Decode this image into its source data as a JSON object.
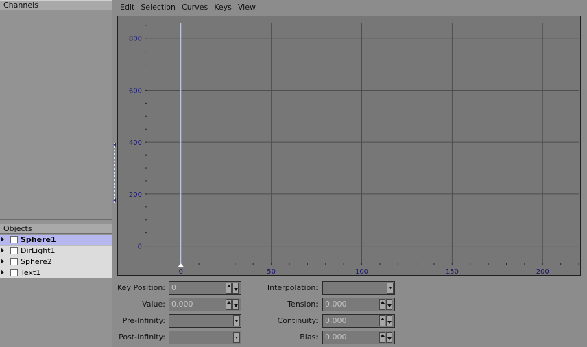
{
  "panels": {
    "channels_title": "Channels",
    "objects_title": "Objects"
  },
  "objects": [
    {
      "label": "Sphere1",
      "selected": true,
      "checked": false
    },
    {
      "label": "DirLight1",
      "selected": false,
      "checked": false
    },
    {
      "label": "Sphere2",
      "selected": false,
      "checked": false
    },
    {
      "label": "Text1",
      "selected": false,
      "checked": false
    }
  ],
  "menu": {
    "edit": "Edit",
    "selection": "Selection",
    "curves": "Curves",
    "keys": "Keys",
    "view": "View"
  },
  "graph": {
    "x_range": [
      -20,
      220
    ],
    "y_range": [
      -75,
      860
    ],
    "x_ticks": [
      "0",
      "50",
      "100",
      "150",
      "200"
    ],
    "y_ticks": [
      "800",
      "600",
      "400",
      "200",
      "0"
    ],
    "time_cursor": 0,
    "colors": {
      "background": "#777777",
      "grid": "#4e4e4e",
      "tick_label": "#16166e",
      "cursor": "#d8e2ff"
    }
  },
  "properties": {
    "key_position": {
      "label": "Key Position:",
      "value": "0"
    },
    "value": {
      "label": "Value:",
      "value": "0.000"
    },
    "pre_infinity": {
      "label": "Pre-Infinity:",
      "value": ""
    },
    "post_infinity": {
      "label": "Post-Infinity:",
      "value": ""
    },
    "interpolation": {
      "label": "Interpolation:",
      "value": ""
    },
    "tension": {
      "label": "Tension:",
      "value": "0.000"
    },
    "continuity": {
      "label": "Continuity:",
      "value": "0.000"
    },
    "bias": {
      "label": "Bias:",
      "value": "0.000"
    }
  }
}
